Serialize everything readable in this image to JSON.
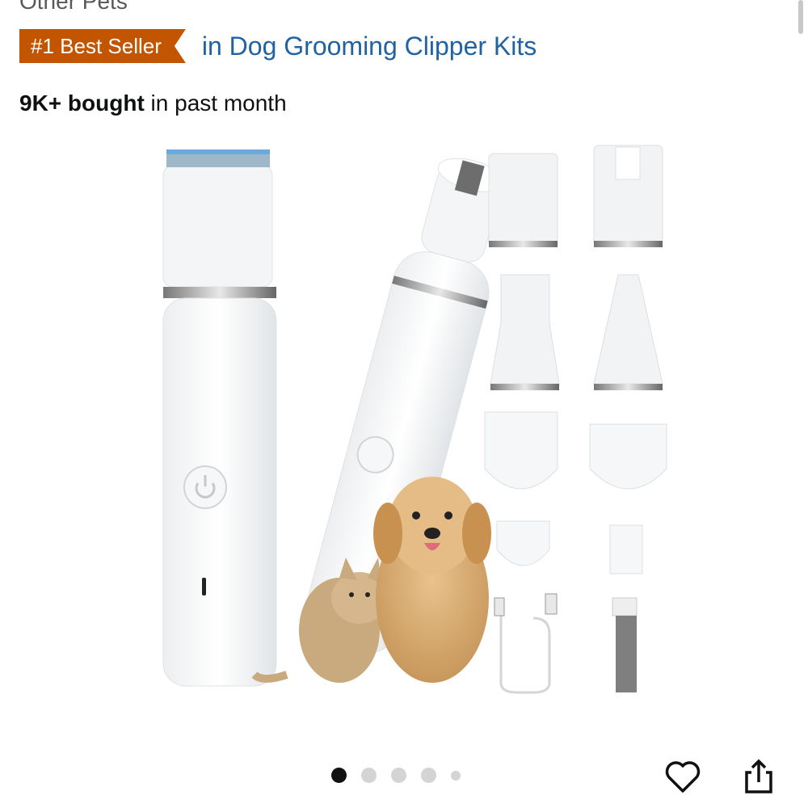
{
  "breadcrumb": {
    "tail": "Other Pets"
  },
  "badge": {
    "label": "#1 Best Seller",
    "category_link": "in Dog Grooming Clipper Kits"
  },
  "social_proof": {
    "bold": "9K+ bought",
    "rest": " in past month"
  },
  "carousel": {
    "count": 5,
    "active_index": 0
  },
  "icons": [
    "heart-icon",
    "share-icon"
  ],
  "colors": {
    "badge_bg": "#c45500",
    "link": "#2162a1"
  }
}
